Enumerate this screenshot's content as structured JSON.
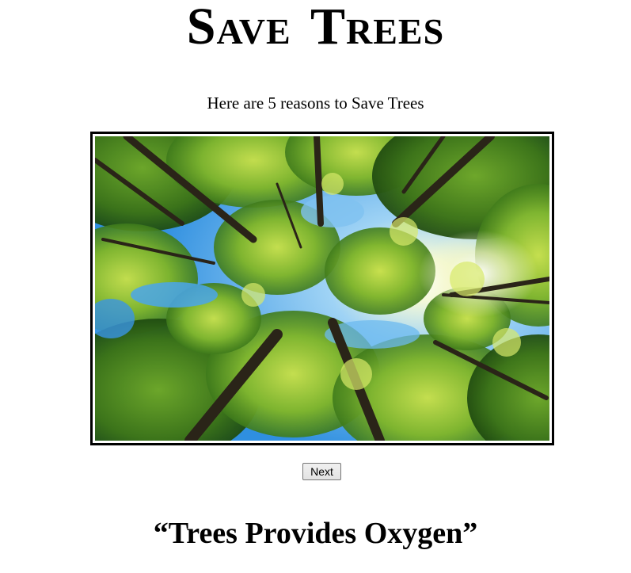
{
  "header": {
    "title": "Save Trees",
    "subtitle": "Here are 5 reasons to Save Trees"
  },
  "slideshow": {
    "image_description_icon": "forest-canopy-image",
    "next_label": "Next",
    "caption": "“Trees Provides Oxygen”"
  },
  "colors": {
    "sky": "#3b9be6",
    "foliage_light": "#a8d23a",
    "foliage_mid": "#5f9e1e",
    "foliage_dark": "#2f5e10",
    "trunk": "#2a2418"
  }
}
